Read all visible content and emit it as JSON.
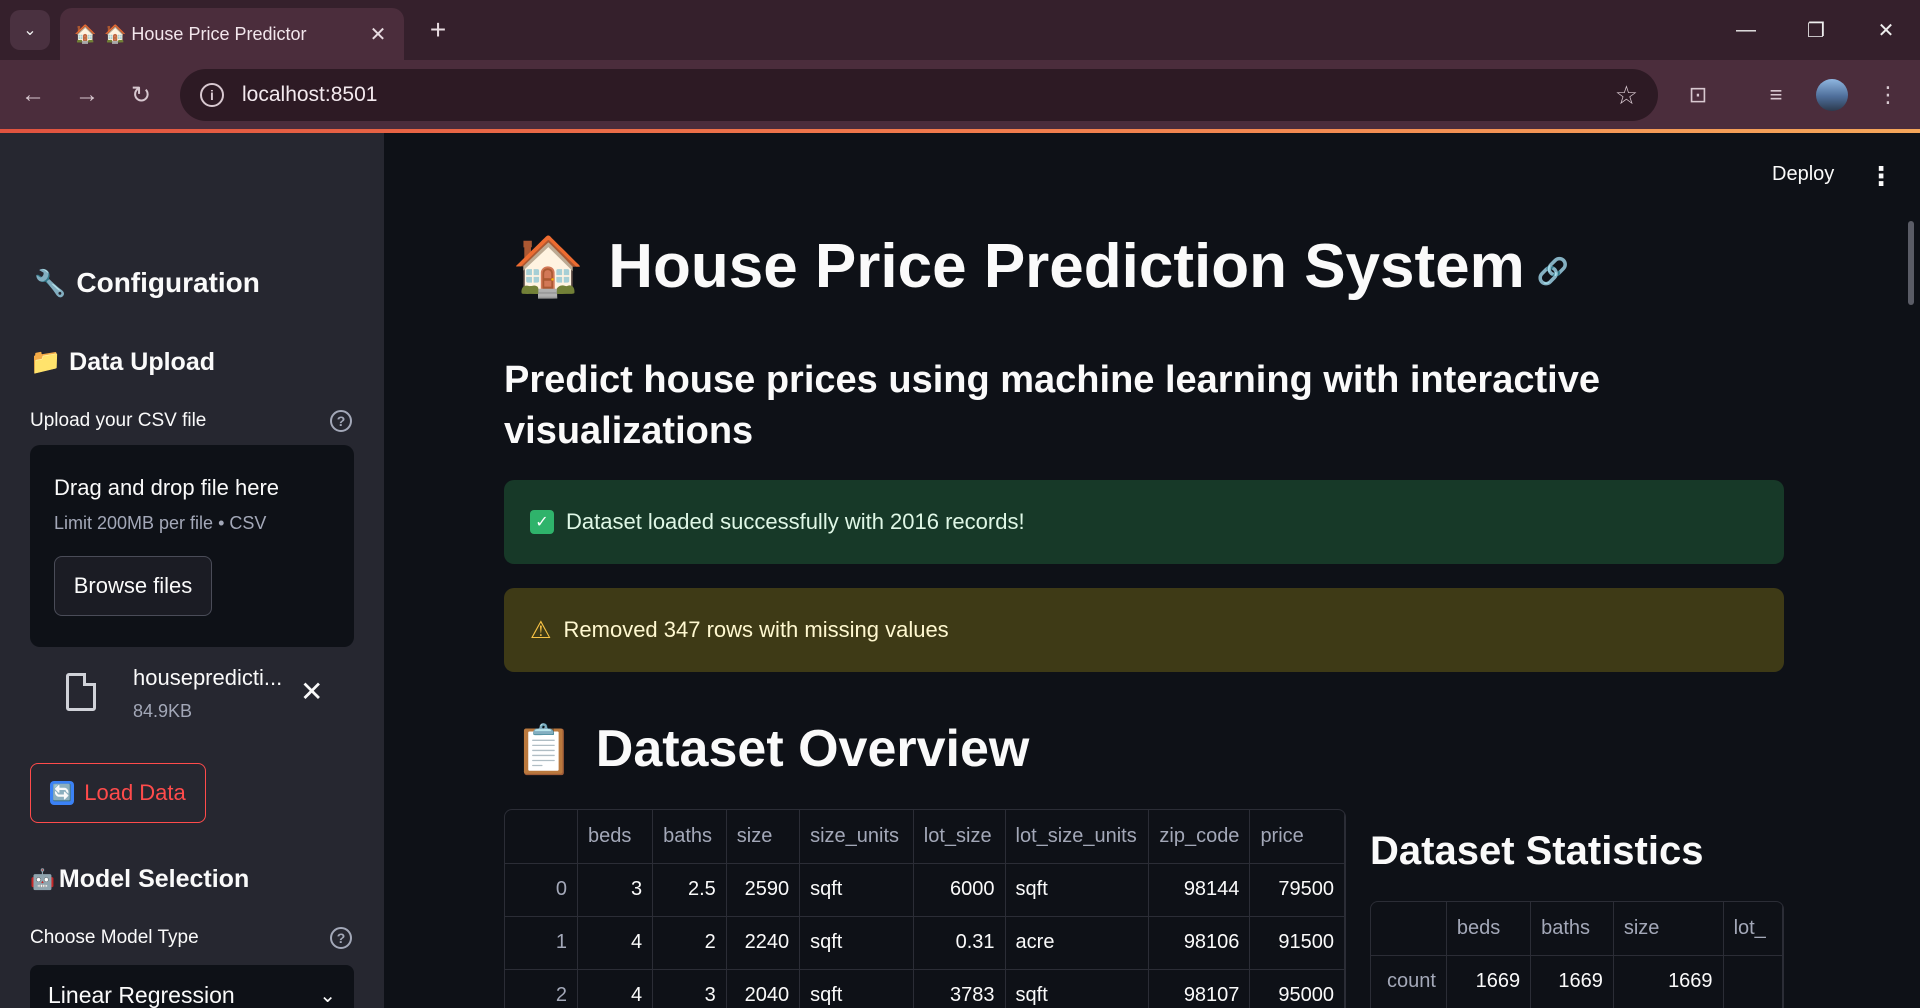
{
  "browser": {
    "tab_title": "🏠 House Price Predictor",
    "url": "localhost:8501"
  },
  "sidebar": {
    "config_title": "Configuration",
    "data_upload_title": "Data Upload",
    "upload_label": "Upload your CSV file",
    "dropzone_title": "Drag and drop file here",
    "dropzone_limit": "Limit 200MB per file • CSV",
    "browse_label": "Browse files",
    "file_name": "housepredicti...",
    "file_size": "84.9KB",
    "load_label": "Load Data",
    "model_title": "Model Selection",
    "model_label": "Choose Model Type",
    "model_value": "Linear Regression"
  },
  "main": {
    "deploy_label": "Deploy",
    "title_emoji": "🏠",
    "title": "House Price Prediction System",
    "subtitle": "Predict house prices using machine learning with interactive visualizations",
    "success_msg": "Dataset loaded successfully with 2016 records!",
    "warning_msg": "Removed 347 rows with missing values",
    "overview_emoji": "📋",
    "overview_title": "Dataset Overview",
    "stats_title": "Dataset Statistics"
  },
  "dataset_table": {
    "columns": [
      "",
      "beds",
      "baths",
      "size",
      "size_units",
      "lot_size",
      "lot_size_units",
      "zip_code",
      "price"
    ],
    "rows": [
      [
        "0",
        "3",
        "2.5",
        "2590",
        "sqft",
        "6000",
        "sqft",
        "98144",
        "79500"
      ],
      [
        "1",
        "4",
        "2",
        "2240",
        "sqft",
        "0.31",
        "acre",
        "98106",
        "91500"
      ],
      [
        "2",
        "4",
        "3",
        "2040",
        "sqft",
        "3783",
        "sqft",
        "98107",
        "95000"
      ]
    ]
  },
  "stats_table": {
    "columns": [
      "",
      "beds",
      "baths",
      "size",
      "lot_"
    ],
    "rows": [
      [
        "count",
        "1669",
        "1669",
        "1669",
        ""
      ]
    ]
  },
  "colors": {
    "accent": "#ff4b4b",
    "success_bg": "#173928",
    "warning_bg": "#3e3a16",
    "sidebar_bg": "#262730",
    "main_bg": "#0e1117"
  }
}
